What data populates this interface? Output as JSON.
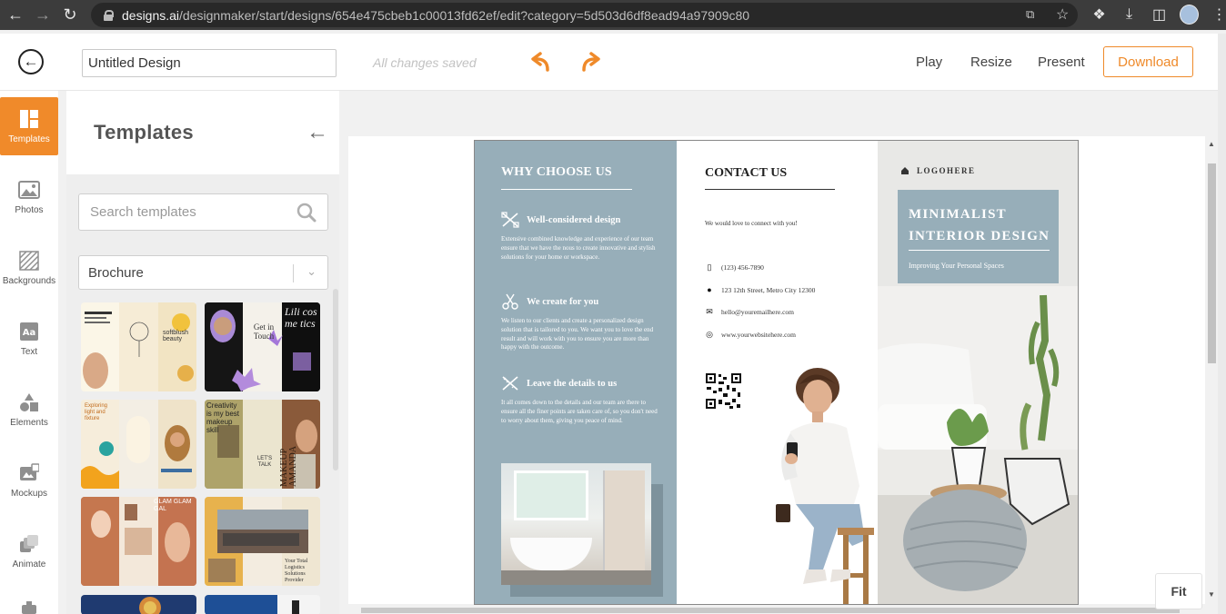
{
  "browser": {
    "url_host": "designs.ai",
    "url_path": "/designmaker/start/designs/654e475cbeb1c00013fd62ef/edit?category=5d503d6df8ead94a97909c80"
  },
  "topbar": {
    "title_value": "Untitled Design",
    "saved_status": "All changes saved",
    "play": "Play",
    "resize": "Resize",
    "present": "Present",
    "download": "Download",
    "accent": "#ef8a2a"
  },
  "rail": {
    "items": [
      {
        "label": "Templates",
        "icon": "templates-icon"
      },
      {
        "label": "Photos",
        "icon": "photo-icon"
      },
      {
        "label": "Backgrounds",
        "icon": "backgrounds-icon"
      },
      {
        "label": "Text",
        "icon": "text-icon"
      },
      {
        "label": "Elements",
        "icon": "elements-icon"
      },
      {
        "label": "Mockups",
        "icon": "mockups-icon"
      },
      {
        "label": "Animate",
        "icon": "animate-icon"
      }
    ]
  },
  "panel": {
    "title": "Templates",
    "search_placeholder": "Search templates",
    "category": "Brochure"
  },
  "thumbnails": {
    "t1": {
      "text_a": "softblush beauty"
    },
    "t2": {
      "text_a": "Get in Touch",
      "text_b": "Lili cos me tics"
    },
    "t3": {
      "text_a": "Exploring light and fixture"
    },
    "t4": {
      "text_a": "Creativity is my best makeup skill",
      "text_b": "LET'S TALK",
      "text_c": "MAKEUP AMANDA"
    },
    "t5": {
      "text_a": "GLAM GLAM GAL"
    },
    "t6": {
      "text_a": "Your Total Logistics Solutions Provider"
    }
  },
  "brochure": {
    "col1": {
      "title": "WHY CHOOSE US",
      "features": [
        {
          "heading": "Well-considered design",
          "body": "Extensive combined knowledge and experience of our team ensure that we have the nous to create innovative and stylish solutions for your home or workspace."
        },
        {
          "heading": "We create for you",
          "body": "We listen to our clients and create a personalized design solution that is tailored to you. We want you to love the end result and will work with you to ensure you are more than happy with the outcome."
        },
        {
          "heading": "Leave the details to us",
          "body": "It all comes down to the details and our team are there to ensure all the finer points are taken care of, so you don't need to worry about them, giving you peace of mind."
        }
      ]
    },
    "col2": {
      "title": "CONTACT US",
      "intro": "We would love to connect with you!",
      "phone": "(123) 456-7890",
      "address": "123 12th Street, Metro City 12300",
      "email": "hello@youremailhere.com",
      "web": "www.yourwebsitehere.com"
    },
    "col3": {
      "logo": "LOGOHERE",
      "title_line1": "MINIMALIST",
      "title_line2": "INTERIOR DESIGN",
      "subtitle": "Improving Your Personal Spaces"
    },
    "panel_color": "#97aeb9"
  },
  "canvas": {
    "fit": "Fit"
  }
}
